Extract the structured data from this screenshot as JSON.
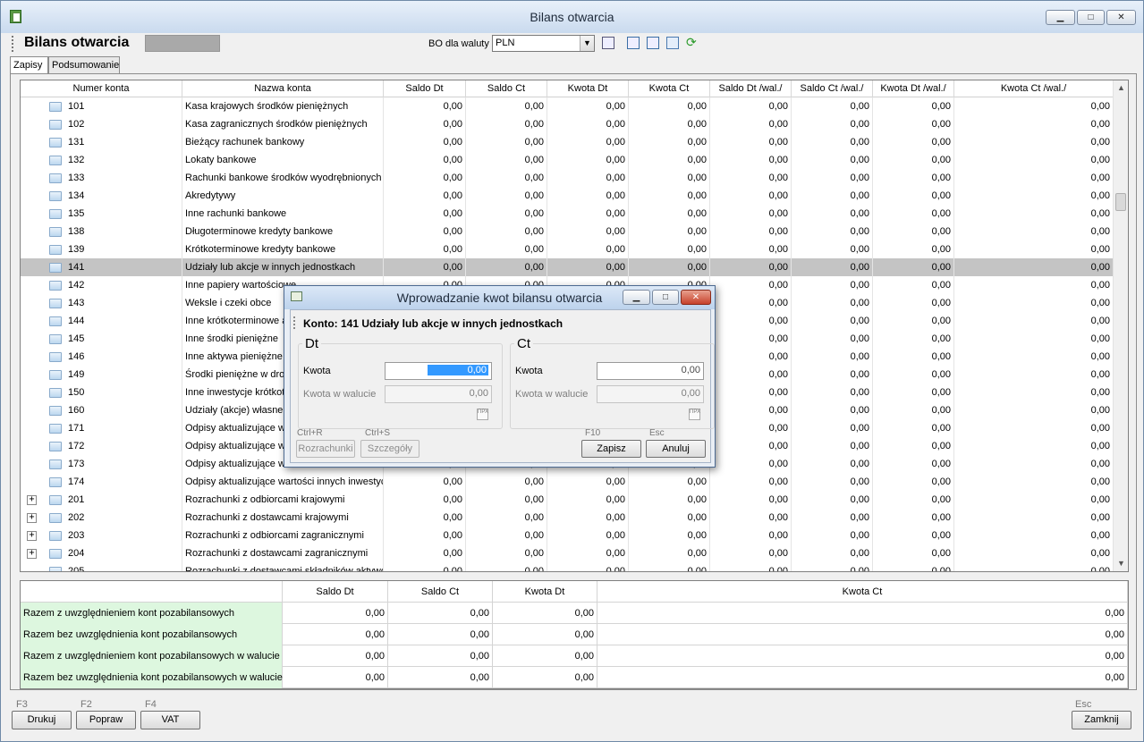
{
  "window": {
    "title": "Bilans otwarcia"
  },
  "toolbar": {
    "title": "Bilans otwarcia",
    "bo_label": "BO dla waluty",
    "currency": "PLN"
  },
  "tabs": [
    {
      "label": "Zapisy"
    },
    {
      "label": "Podsumowanie"
    }
  ],
  "grid": {
    "columns": [
      "Numer konta",
      "Nazwa konta",
      "Saldo Dt",
      "Saldo Ct",
      "Kwota Dt",
      "Kwota Ct",
      "Saldo Dt /wal./",
      "Saldo Ct /wal./",
      "Kwota Dt /wal./",
      "Kwota Ct /wal./"
    ],
    "zero": "0,00",
    "rows": [
      {
        "no": "101",
        "name": "Kasa krajowych środków pieniężnych"
      },
      {
        "no": "102",
        "name": "Kasa zagranicznych środków pieniężnych"
      },
      {
        "no": "131",
        "name": "Bieżący rachunek bankowy"
      },
      {
        "no": "132",
        "name": "Lokaty bankowe"
      },
      {
        "no": "133",
        "name": "Rachunki bankowe środków wyodrębnionych"
      },
      {
        "no": "134",
        "name": "Akredytywy"
      },
      {
        "no": "135",
        "name": "Inne rachunki bankowe"
      },
      {
        "no": "138",
        "name": "Długoterminowe kredyty bankowe"
      },
      {
        "no": "139",
        "name": "Krótkoterminowe kredyty bankowe"
      },
      {
        "no": "141",
        "name": "Udziały lub akcje w innych jednostkach",
        "selected": true
      },
      {
        "no": "142",
        "name": "Inne papiery wartościowe"
      },
      {
        "no": "143",
        "name": "Weksle i czeki obce"
      },
      {
        "no": "144",
        "name": "Inne krótkoterminowe aktywa finansowe"
      },
      {
        "no": "145",
        "name": "Inne środki pieniężne"
      },
      {
        "no": "146",
        "name": "Inne aktywa pieniężne"
      },
      {
        "no": "149",
        "name": "Środki pieniężne w drodze"
      },
      {
        "no": "150",
        "name": "Inne inwestycje krótkoterminowe"
      },
      {
        "no": "160",
        "name": "Udziały (akcje) własne"
      },
      {
        "no": "171",
        "name": "Odpisy aktualizujące wartość udziałów"
      },
      {
        "no": "172",
        "name": "Odpisy aktualizujące wartość papierów"
      },
      {
        "no": "173",
        "name": "Odpisy aktualizujące wartość weksli"
      },
      {
        "no": "174",
        "name": "Odpisy aktualizujące wartości innych inwestycji"
      },
      {
        "no": "201",
        "name": "Rozrachunki z odbiorcami krajowymi",
        "expandable": true
      },
      {
        "no": "202",
        "name": "Rozrachunki z dostawcami krajowymi",
        "expandable": true
      },
      {
        "no": "203",
        "name": "Rozrachunki z odbiorcami zagranicznymi",
        "expandable": true
      },
      {
        "no": "204",
        "name": "Rozrachunki z dostawcami zagranicznymi",
        "expandable": true
      },
      {
        "no": "205",
        "name": "Rozrachunki z dostawcami składników aktywów"
      }
    ]
  },
  "summary": {
    "columns": [
      "Saldo Dt",
      "Saldo Ct",
      "Kwota Dt",
      "Kwota Ct"
    ],
    "rows": [
      {
        "label": "Razem z uwzględnieniem kont pozabilansowych",
        "values": [
          "0,00",
          "0,00",
          "0,00",
          "0,00"
        ]
      },
      {
        "label": "Razem bez uwzględnienia kont pozabilansowych",
        "values": [
          "0,00",
          "0,00",
          "0,00",
          "0,00"
        ]
      },
      {
        "label": "Razem z uwzględnieniem kont pozabilansowych w walucie",
        "values": [
          "0,00",
          "0,00",
          "0,00",
          "0,00"
        ]
      },
      {
        "label": "Razem bez uwzględnienia kont pozabilansowych w walucie",
        "values": [
          "0,00",
          "0,00",
          "0,00",
          "0,00"
        ]
      }
    ]
  },
  "footer": {
    "drukuj": {
      "key": "F3",
      "label": "Drukuj"
    },
    "popraw": {
      "key": "F2",
      "label": "Popraw"
    },
    "vat": {
      "key": "F4",
      "label": "VAT"
    },
    "zamknij": {
      "key": "Esc",
      "label": "Zamknij"
    }
  },
  "dialog": {
    "title": "Wprowadzanie kwot bilansu otwarcia",
    "account": "Konto: 141 Udziały lub akcje w innych jednostkach",
    "dt": {
      "title": "Dt",
      "kwota_label": "Kwota",
      "kwota": "0,00",
      "waluta_label": "Kwota w walucie",
      "waluta": "0,00"
    },
    "ct": {
      "title": "Ct",
      "kwota_label": "Kwota",
      "kwota": "0,00",
      "waluta_label": "Kwota w walucie",
      "waluta": "0,00"
    },
    "rozrachunki": {
      "key": "Ctrl+R",
      "label": "Rozrachunki"
    },
    "szczegoly": {
      "key": "Ctrl+S",
      "label": "Szczegóły"
    },
    "zapisz": {
      "key": "F10",
      "label": "Zapisz"
    },
    "anuluj": {
      "key": "Esc",
      "label": "Anuluj"
    }
  }
}
